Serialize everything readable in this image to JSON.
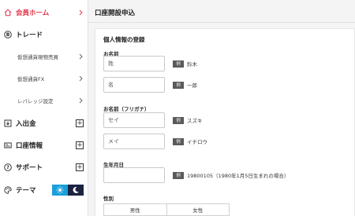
{
  "sidebar": {
    "items": [
      {
        "label": "会員ホーム"
      },
      {
        "label": "トレード"
      },
      {
        "label": "仮想通貨現物売買"
      },
      {
        "label": "仮想通貨FX"
      },
      {
        "label": "レバレッジ設定"
      },
      {
        "label": "入出金"
      },
      {
        "label": "口座情報"
      },
      {
        "label": "サポート"
      },
      {
        "label": "テーマ"
      }
    ],
    "icons": {
      "home": "home-icon",
      "trade": "bitcoin-icon",
      "deposit": "deposit-icon",
      "account": "id-card-icon",
      "support": "help-icon",
      "theme": "palette-icon",
      "sun": "sun-icon",
      "moon": "moon-icon"
    },
    "accent_color": "#e2374a",
    "theme_light_color": "#1a9fd9",
    "theme_dark_color": "#1b2340"
  },
  "main": {
    "title": "口座開設申込",
    "section_title": "個人情報の登録",
    "example_badge": "例",
    "name": {
      "label": "お名前",
      "last_placeholder": "姓",
      "last_example": "鈴木",
      "first_placeholder": "名",
      "first_example": "一郎"
    },
    "kana": {
      "label": "お名前（フリガナ）",
      "last_placeholder": "セイ",
      "last_example": "スズキ",
      "first_placeholder": "メイ",
      "first_example": "イチロウ"
    },
    "birth": {
      "label": "生年月日",
      "value": "",
      "example": "19800105（1980年1月5日生まれの場合）"
    },
    "gender": {
      "label": "性別",
      "options": [
        "男性",
        "女性"
      ]
    }
  }
}
